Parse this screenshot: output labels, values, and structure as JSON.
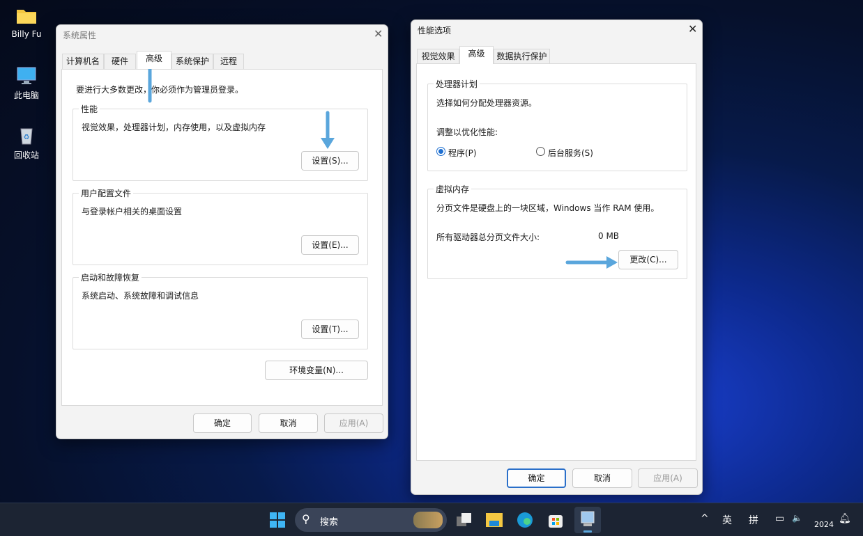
{
  "desktop": {
    "icons": [
      {
        "label": "Billy Fu",
        "icon": "folder-icon"
      },
      {
        "label": "此电脑",
        "icon": "monitor-icon"
      },
      {
        "label": "回收站",
        "icon": "recycle-bin-icon"
      }
    ]
  },
  "sys_props": {
    "title": "系统属性",
    "tabs": [
      "计算机名",
      "硬件",
      "高级",
      "系统保护",
      "远程"
    ],
    "selected_tab": "高级",
    "admin_note": "要进行大多数更改，你必须作为管理员登录。",
    "groups": [
      {
        "label": "性能",
        "desc": "视觉效果，处理器计划，内存使用，以及虚拟内存",
        "button": "设置(S)..."
      },
      {
        "label": "用户配置文件",
        "desc": "与登录帐户相关的桌面设置",
        "button": "设置(E)..."
      },
      {
        "label": "启动和故障恢复",
        "desc": "系统启动、系统故障和调试信息",
        "button": "设置(T)..."
      }
    ],
    "env_button": "环境变量(N)...",
    "ok": "确定",
    "cancel": "取消",
    "apply": "应用(A)"
  },
  "perf_opts": {
    "title": "性能选项",
    "tabs": [
      "视觉效果",
      "高级",
      "数据执行保护"
    ],
    "selected_tab": "高级",
    "cpu": {
      "label": "处理器计划",
      "desc": "选择如何分配处理器资源。",
      "optimize": "调整以优化性能:",
      "opt_programs": "程序(P)",
      "opt_services": "后台服务(S)",
      "selected": "程序(P)"
    },
    "vm": {
      "label": "虚拟内存",
      "desc": "分页文件是硬盘上的一块区域，Windows 当作 RAM 使用。",
      "total_label": "所有驱动器总分页文件大小:",
      "total_value": "0 MB",
      "change": "更改(C)..."
    },
    "ok": "确定",
    "cancel": "取消",
    "apply": "应用(A)"
  },
  "taskbar": {
    "search": "搜索",
    "ime_lang": "英",
    "ime_mode": "拼",
    "clock": "2024"
  },
  "colors": {
    "accent": "#2a6fc9",
    "arrow": "#5aa6dc"
  }
}
